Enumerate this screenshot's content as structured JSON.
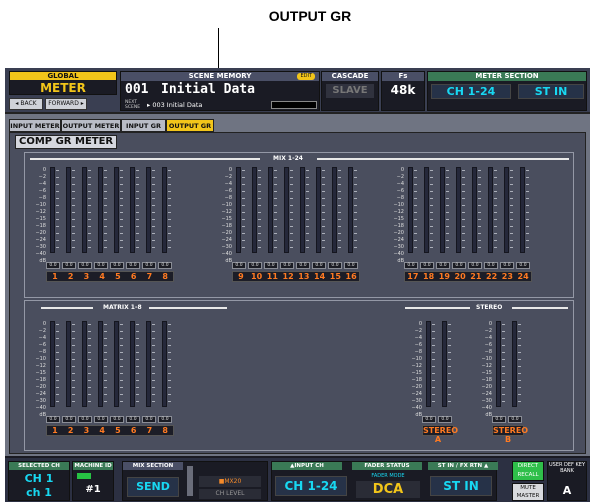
{
  "callout": "OUTPUT GR",
  "header": {
    "global_label": "GLOBAL",
    "global_value": "METER",
    "back": "◂ BACK",
    "forward": "FORWARD ▸",
    "scene_label": "SCENE MEMORY",
    "edit_badge": "EDIT",
    "scene_num": "001",
    "scene_name": "Initial Data",
    "next_label": "NEXT SCENE",
    "next_scene": "▸ 003 Initial Data",
    "cascade_label": "CASCADE",
    "cascade_value": "SLAVE",
    "fs_label": "Fs",
    "fs_value": "48k",
    "meter_label": "METER SECTION",
    "meter_a": "CH 1-24",
    "meter_b": "ST IN"
  },
  "tabs": [
    "INPUT METER",
    "OUTPUT METER",
    "INPUT GR",
    "OUTPUT GR"
  ],
  "panel_title": "COMP GR METER",
  "scale": [
    "0",
    "−2",
    "−4",
    "−6",
    "−8",
    "−10",
    "−12",
    "−15",
    "−18",
    "−20",
    "−24",
    "−30",
    "−40",
    "dB"
  ],
  "meter_value": "0.0",
  "mix": {
    "title": "MIX 1-24",
    "labels": [
      "1",
      "2",
      "3",
      "4",
      "5",
      "6",
      "7",
      "8",
      "9",
      "10",
      "11",
      "12",
      "13",
      "14",
      "15",
      "16",
      "17",
      "18",
      "19",
      "20",
      "21",
      "22",
      "23",
      "24"
    ]
  },
  "matrix": {
    "title": "MATRIX 1-8",
    "labels": [
      "1",
      "2",
      "3",
      "4",
      "5",
      "6",
      "7",
      "8"
    ]
  },
  "stereo": {
    "title": "STEREO",
    "a": "STEREO A",
    "b": "STEREO B",
    "channels": [
      "L",
      "R"
    ]
  },
  "footer": {
    "sel_label": "SELECTED CH",
    "sel_top": "CH 1",
    "sel_bottom": "ch 1",
    "machine_label": "MACHINE ID",
    "machine_value": "#1",
    "mix_label": "MIX SECTION",
    "send": "SEND",
    "mx": "■MX20",
    "chlevel": "CH LEVEL",
    "input_label": "▲INPUT CH",
    "input_value": "CH 1-24",
    "fader_label": "FADER STATUS",
    "fader_mode": "FADER MODE",
    "fader_value": "DCA",
    "st_label": "ST IN / FX RTN ▲",
    "st_value": "ST IN",
    "direct": "DIRECT RECALL",
    "mute": "MUTE MASTER",
    "userdef_label": "USER DEF KEY BANK",
    "userdef_value": "A"
  }
}
